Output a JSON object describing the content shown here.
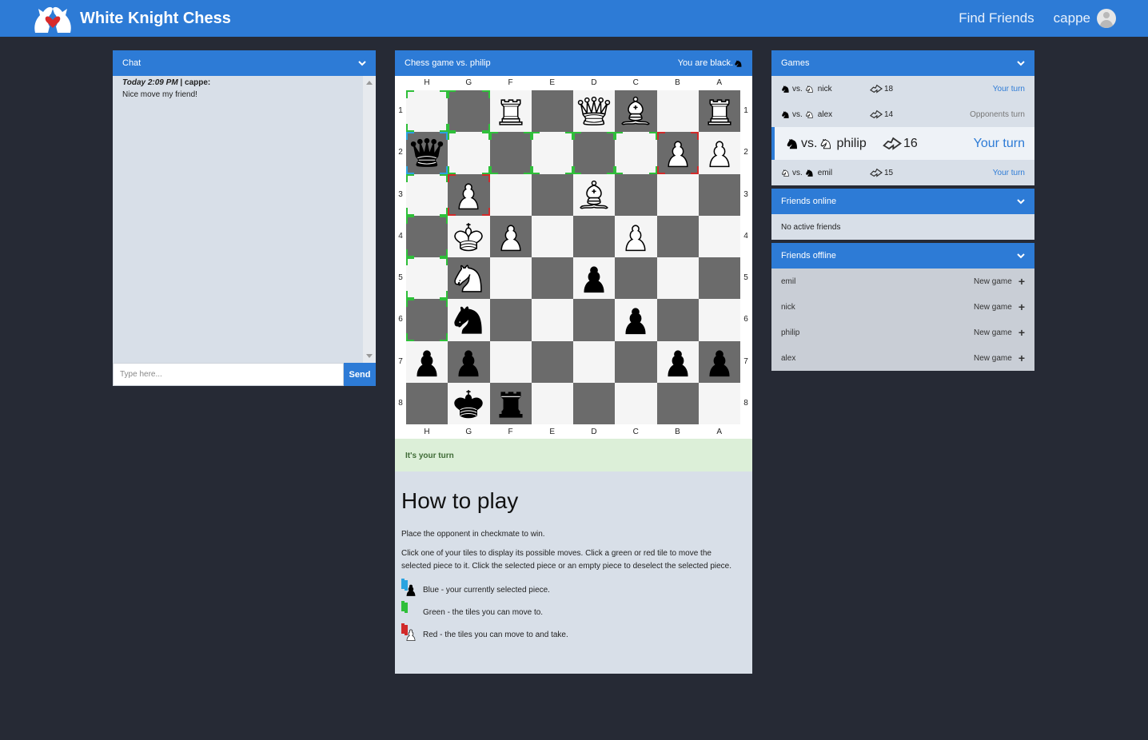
{
  "brand": {
    "name": "White Knight Chess"
  },
  "nav": {
    "find_friends": "Find Friends",
    "username": "cappe"
  },
  "chat": {
    "title": "Chat",
    "messages": [
      {
        "time": "Today 2:09 PM",
        "sender": "cappe:",
        "text": "Nice move my friend!"
      }
    ],
    "input_placeholder": "Type here...",
    "send_label": "Send"
  },
  "game": {
    "title": "Chess game vs. philip",
    "you_are": "You are black.",
    "columns": [
      "H",
      "G",
      "F",
      "E",
      "D",
      "C",
      "B",
      "A"
    ],
    "rows": [
      "1",
      "2",
      "3",
      "4",
      "5",
      "6",
      "7",
      "8"
    ],
    "turn_text": "It's your turn",
    "board": [
      [
        "",
        "",
        "wR",
        "",
        "wQ",
        "wB",
        "",
        "wR"
      ],
      [
        "bQ",
        "",
        "",
        "",
        "",
        "",
        "wP",
        "wP"
      ],
      [
        "",
        "wP",
        "",
        "",
        "wB",
        "",
        "",
        ""
      ],
      [
        "",
        "wK",
        "wP",
        "",
        "",
        "wP",
        "",
        ""
      ],
      [
        "",
        "wN",
        "",
        "",
        "bP",
        "",
        "",
        ""
      ],
      [
        "",
        "bN",
        "",
        "",
        "",
        "bP",
        "",
        ""
      ],
      [
        "bP",
        "bP",
        "",
        "",
        "",
        "",
        "bP",
        "bP"
      ],
      [
        "",
        "bK",
        "bR",
        "",
        "",
        "",
        "",
        ""
      ]
    ],
    "selected": [
      [
        1,
        0
      ]
    ],
    "green_moves": [
      [
        0,
        0
      ],
      [
        0,
        1
      ],
      [
        1,
        1
      ],
      [
        1,
        2
      ],
      [
        1,
        3
      ],
      [
        1,
        4
      ],
      [
        1,
        5
      ],
      [
        2,
        0
      ],
      [
        3,
        0
      ],
      [
        4,
        0
      ],
      [
        5,
        0
      ]
    ],
    "red_moves": [
      [
        1,
        6
      ],
      [
        2,
        1
      ]
    ]
  },
  "howto": {
    "title": "How to play",
    "p1": "Place the opponent in checkmate to win.",
    "p2": "Click one of your tiles to display its possible moves. Click a green or red tile to move the selected piece to it. Click the selected piece or an empty piece to deselect the selected piece.",
    "legend_blue": "Blue - your currently selected piece.",
    "legend_green": "Green - the tiles you can move to.",
    "legend_red": "Red - the tiles you can move to and take."
  },
  "games": {
    "title": "Games",
    "list": [
      {
        "vs": "vs.",
        "opponent": "nick",
        "moves": "18",
        "status": "Your turn",
        "you_black": true
      },
      {
        "vs": "vs.",
        "opponent": "alex",
        "moves": "14",
        "status": "Opponents turn",
        "you_black": true
      },
      {
        "vs": "vs.",
        "opponent": "philip",
        "moves": "16",
        "status": "Your turn",
        "you_black": true
      },
      {
        "vs": "vs.",
        "opponent": "emil",
        "moves": "15",
        "status": "Your turn",
        "you_black": false
      }
    ]
  },
  "friends_online": {
    "title": "Friends online",
    "empty": "No active friends"
  },
  "friends_offline": {
    "title": "Friends offline",
    "new_game_label": "New game",
    "list": [
      "emil",
      "nick",
      "philip",
      "alex"
    ]
  },
  "colors": {
    "accent": "#2d7bd6",
    "background": "#262a35",
    "panel": "#d8dfe8",
    "green_marker": "#2fbf3a",
    "red_marker": "#d12a2a",
    "blue_marker": "#2aa3e0"
  }
}
